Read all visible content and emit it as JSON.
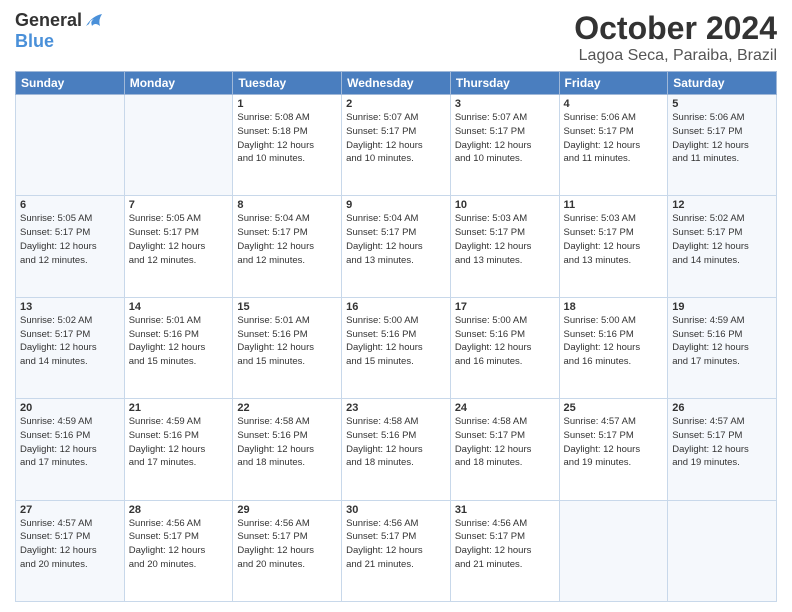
{
  "logo": {
    "general": "General",
    "blue": "Blue"
  },
  "header": {
    "month": "October 2024",
    "location": "Lagoa Seca, Paraiba, Brazil"
  },
  "days_of_week": [
    "Sunday",
    "Monday",
    "Tuesday",
    "Wednesday",
    "Thursday",
    "Friday",
    "Saturday"
  ],
  "weeks": [
    [
      {
        "day": "",
        "info": ""
      },
      {
        "day": "",
        "info": ""
      },
      {
        "day": "1",
        "info": "Sunrise: 5:08 AM\nSunset: 5:18 PM\nDaylight: 12 hours\nand 10 minutes."
      },
      {
        "day": "2",
        "info": "Sunrise: 5:07 AM\nSunset: 5:17 PM\nDaylight: 12 hours\nand 10 minutes."
      },
      {
        "day": "3",
        "info": "Sunrise: 5:07 AM\nSunset: 5:17 PM\nDaylight: 12 hours\nand 10 minutes."
      },
      {
        "day": "4",
        "info": "Sunrise: 5:06 AM\nSunset: 5:17 PM\nDaylight: 12 hours\nand 11 minutes."
      },
      {
        "day": "5",
        "info": "Sunrise: 5:06 AM\nSunset: 5:17 PM\nDaylight: 12 hours\nand 11 minutes."
      }
    ],
    [
      {
        "day": "6",
        "info": "Sunrise: 5:05 AM\nSunset: 5:17 PM\nDaylight: 12 hours\nand 12 minutes."
      },
      {
        "day": "7",
        "info": "Sunrise: 5:05 AM\nSunset: 5:17 PM\nDaylight: 12 hours\nand 12 minutes."
      },
      {
        "day": "8",
        "info": "Sunrise: 5:04 AM\nSunset: 5:17 PM\nDaylight: 12 hours\nand 12 minutes."
      },
      {
        "day": "9",
        "info": "Sunrise: 5:04 AM\nSunset: 5:17 PM\nDaylight: 12 hours\nand 13 minutes."
      },
      {
        "day": "10",
        "info": "Sunrise: 5:03 AM\nSunset: 5:17 PM\nDaylight: 12 hours\nand 13 minutes."
      },
      {
        "day": "11",
        "info": "Sunrise: 5:03 AM\nSunset: 5:17 PM\nDaylight: 12 hours\nand 13 minutes."
      },
      {
        "day": "12",
        "info": "Sunrise: 5:02 AM\nSunset: 5:17 PM\nDaylight: 12 hours\nand 14 minutes."
      }
    ],
    [
      {
        "day": "13",
        "info": "Sunrise: 5:02 AM\nSunset: 5:17 PM\nDaylight: 12 hours\nand 14 minutes."
      },
      {
        "day": "14",
        "info": "Sunrise: 5:01 AM\nSunset: 5:16 PM\nDaylight: 12 hours\nand 15 minutes."
      },
      {
        "day": "15",
        "info": "Sunrise: 5:01 AM\nSunset: 5:16 PM\nDaylight: 12 hours\nand 15 minutes."
      },
      {
        "day": "16",
        "info": "Sunrise: 5:00 AM\nSunset: 5:16 PM\nDaylight: 12 hours\nand 15 minutes."
      },
      {
        "day": "17",
        "info": "Sunrise: 5:00 AM\nSunset: 5:16 PM\nDaylight: 12 hours\nand 16 minutes."
      },
      {
        "day": "18",
        "info": "Sunrise: 5:00 AM\nSunset: 5:16 PM\nDaylight: 12 hours\nand 16 minutes."
      },
      {
        "day": "19",
        "info": "Sunrise: 4:59 AM\nSunset: 5:16 PM\nDaylight: 12 hours\nand 17 minutes."
      }
    ],
    [
      {
        "day": "20",
        "info": "Sunrise: 4:59 AM\nSunset: 5:16 PM\nDaylight: 12 hours\nand 17 minutes."
      },
      {
        "day": "21",
        "info": "Sunrise: 4:59 AM\nSunset: 5:16 PM\nDaylight: 12 hours\nand 17 minutes."
      },
      {
        "day": "22",
        "info": "Sunrise: 4:58 AM\nSunset: 5:16 PM\nDaylight: 12 hours\nand 18 minutes."
      },
      {
        "day": "23",
        "info": "Sunrise: 4:58 AM\nSunset: 5:16 PM\nDaylight: 12 hours\nand 18 minutes."
      },
      {
        "day": "24",
        "info": "Sunrise: 4:58 AM\nSunset: 5:17 PM\nDaylight: 12 hours\nand 18 minutes."
      },
      {
        "day": "25",
        "info": "Sunrise: 4:57 AM\nSunset: 5:17 PM\nDaylight: 12 hours\nand 19 minutes."
      },
      {
        "day": "26",
        "info": "Sunrise: 4:57 AM\nSunset: 5:17 PM\nDaylight: 12 hours\nand 19 minutes."
      }
    ],
    [
      {
        "day": "27",
        "info": "Sunrise: 4:57 AM\nSunset: 5:17 PM\nDaylight: 12 hours\nand 20 minutes."
      },
      {
        "day": "28",
        "info": "Sunrise: 4:56 AM\nSunset: 5:17 PM\nDaylight: 12 hours\nand 20 minutes."
      },
      {
        "day": "29",
        "info": "Sunrise: 4:56 AM\nSunset: 5:17 PM\nDaylight: 12 hours\nand 20 minutes."
      },
      {
        "day": "30",
        "info": "Sunrise: 4:56 AM\nSunset: 5:17 PM\nDaylight: 12 hours\nand 21 minutes."
      },
      {
        "day": "31",
        "info": "Sunrise: 4:56 AM\nSunset: 5:17 PM\nDaylight: 12 hours\nand 21 minutes."
      },
      {
        "day": "",
        "info": ""
      },
      {
        "day": "",
        "info": ""
      }
    ]
  ]
}
